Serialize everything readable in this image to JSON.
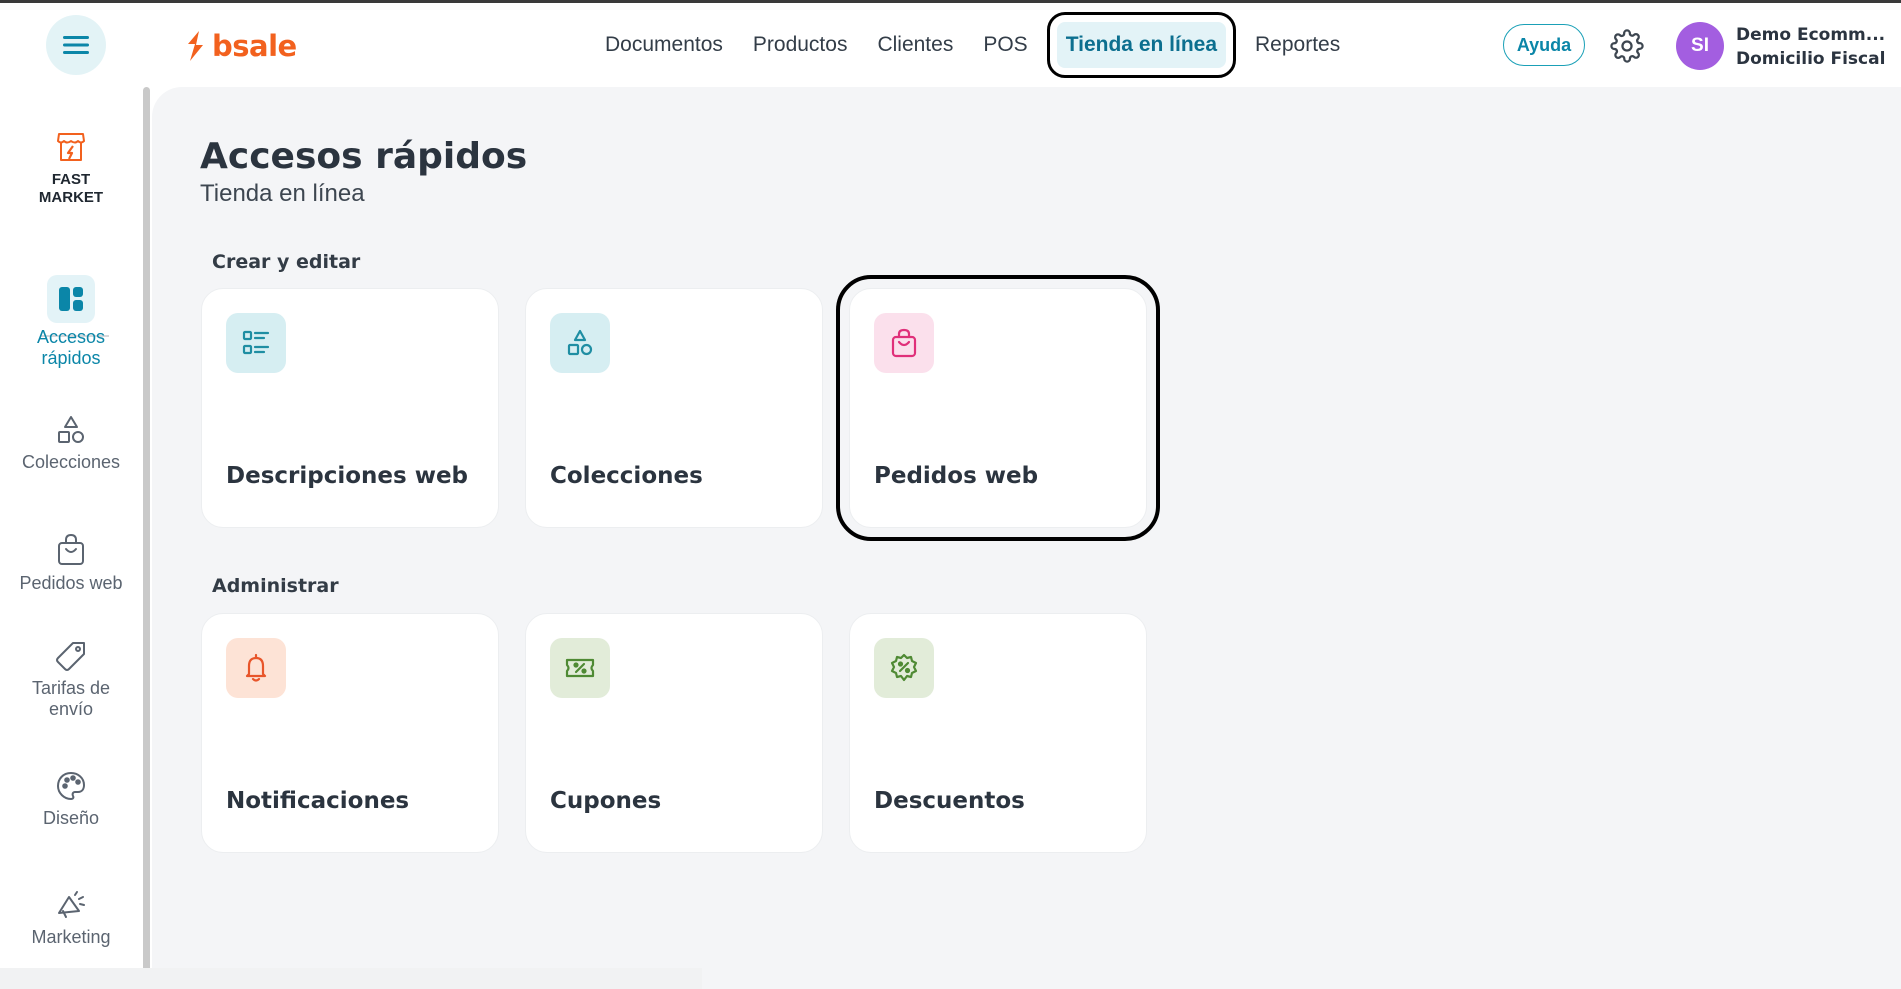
{
  "header": {
    "logo_text": "bsale",
    "nav": [
      {
        "label": "Documentos",
        "active": false
      },
      {
        "label": "Productos",
        "active": false
      },
      {
        "label": "Clientes",
        "active": false
      },
      {
        "label": "POS",
        "active": false
      },
      {
        "label": "Tienda en línea",
        "active": true
      },
      {
        "label": "Reportes",
        "active": false
      }
    ],
    "help_label": "Ayuda",
    "avatar_initials": "SI",
    "account_name": "Demo Ecomm...",
    "account_branch": "Domicilio Fiscal"
  },
  "sidebar": {
    "store_label_line1": "FAST",
    "store_label_line2": "MARKET",
    "items": [
      {
        "label_line1": "Accesos",
        "label_line2": "rápidos",
        "icon": "dashboard-icon",
        "active": true
      },
      {
        "label_line1": "Colecciones",
        "label_line2": "",
        "icon": "shapes-icon",
        "active": false
      },
      {
        "label_line1": "Pedidos web",
        "label_line2": "",
        "icon": "shopping-bag-icon",
        "active": false
      },
      {
        "label_line1": "Tarifas de",
        "label_line2": "envío",
        "icon": "tag-icon",
        "active": false
      },
      {
        "label_line1": "Diseño",
        "label_line2": "",
        "icon": "palette-icon",
        "active": false
      },
      {
        "label_line1": "Marketing",
        "label_line2": "",
        "icon": "megaphone-icon",
        "active": false
      }
    ]
  },
  "main": {
    "title": "Accesos rápidos",
    "subtitle": "Tienda en línea",
    "sections": [
      {
        "title": "Crear y editar",
        "cards": [
          {
            "label": "Descripciones web",
            "icon": "list-icon",
            "icon_bg": "#d6eef2",
            "icon_color": "#1f8ea3"
          },
          {
            "label": "Colecciones",
            "icon": "shapes-icon",
            "icon_bg": "#d6eef2",
            "icon_color": "#1f8ea3"
          },
          {
            "label": "Pedidos web",
            "icon": "shopping-bag-icon",
            "icon_bg": "#fbe0ec",
            "icon_color": "#e0307a"
          }
        ]
      },
      {
        "title": "Administrar",
        "cards": [
          {
            "label": "Notificaciones",
            "icon": "bell-icon",
            "icon_bg": "#fde3d6",
            "icon_color": "#e8552a"
          },
          {
            "label": "Cupones",
            "icon": "coupon-icon",
            "icon_bg": "#e2ecd9",
            "icon_color": "#4f8a34"
          },
          {
            "label": "Descuentos",
            "icon": "discount-badge-icon",
            "icon_bg": "#e2ecd9",
            "icon_color": "#4f8a34"
          }
        ]
      }
    ]
  },
  "colors": {
    "brand": "#f2611e",
    "accent": "#0b86a8",
    "avatar": "#a35ee0"
  }
}
